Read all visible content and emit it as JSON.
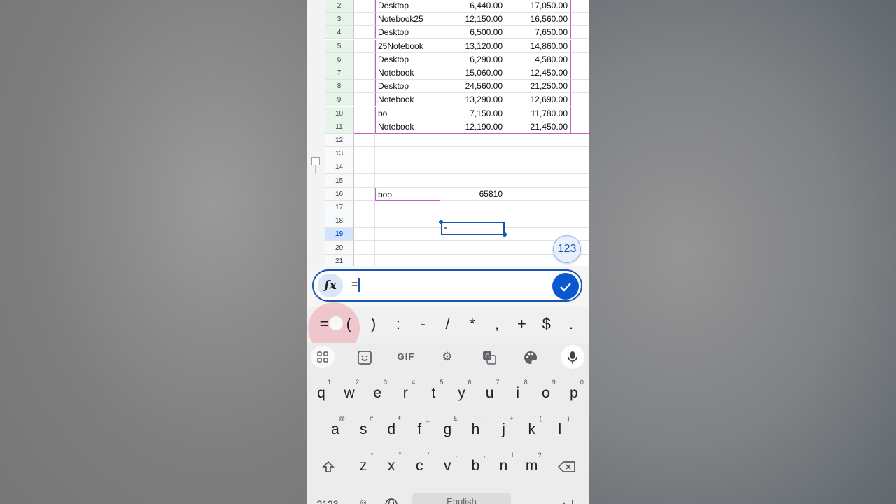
{
  "sheet": {
    "rows": [
      {
        "num": "2",
        "a": "Desktop",
        "b": "6,440.00",
        "c": "17,050.00"
      },
      {
        "num": "3",
        "a": "Notebook25",
        "b": "12,150.00",
        "c": "16,560.00"
      },
      {
        "num": "4",
        "a": "Desktop",
        "b": "6,500.00",
        "c": "7,650.00"
      },
      {
        "num": "5",
        "a": "25Notebook",
        "b": "13,120.00",
        "c": "14,860.00"
      },
      {
        "num": "6",
        "a": "Desktop",
        "b": "6,290.00",
        "c": "4,580.00"
      },
      {
        "num": "7",
        "a": "Notebook",
        "b": "15,060.00",
        "c": "12,450.00"
      },
      {
        "num": "8",
        "a": "Desktop",
        "b": "24,560.00",
        "c": "21,250.00"
      },
      {
        "num": "9",
        "a": "Notebook",
        "b": "13,290.00",
        "c": "12,690.00"
      },
      {
        "num": "10",
        "a": "bo",
        "b": "7,150.00",
        "c": "11,780.00"
      },
      {
        "num": "11",
        "a": "Notebook",
        "b": "12,190.00",
        "c": "21,450.00"
      }
    ],
    "empty_rows": [
      "12",
      "13",
      "14",
      "15",
      "16",
      "17",
      "18",
      "19",
      "20",
      "21"
    ],
    "row16_a": "boo",
    "row16_b": "65810",
    "active_cell_text": "=",
    "badge": "123"
  },
  "formula": {
    "icon": "fx",
    "text": "="
  },
  "symbols": [
    "=",
    "(",
    ")",
    ":",
    "-",
    "/",
    "*",
    ",",
    "+",
    "$",
    "."
  ],
  "toolbar": {
    "gif_label": "GIF"
  },
  "keyboard": {
    "row1": [
      [
        "q",
        "1"
      ],
      [
        "w",
        "2"
      ],
      [
        "e",
        "3"
      ],
      [
        "r",
        "4"
      ],
      [
        "t",
        "5"
      ],
      [
        "y",
        "6"
      ],
      [
        "u",
        "7"
      ],
      [
        "i",
        "8"
      ],
      [
        "o",
        "9"
      ],
      [
        "p",
        "0"
      ]
    ],
    "row2": [
      [
        "a",
        "@"
      ],
      [
        "s",
        "#"
      ],
      [
        "d",
        "₹"
      ],
      [
        "f",
        "_"
      ],
      [
        "g",
        "&"
      ],
      [
        "h",
        "-"
      ],
      [
        "j",
        "+"
      ],
      [
        "k",
        "("
      ],
      [
        "l",
        ")"
      ]
    ],
    "row3": [
      [
        "z",
        "*"
      ],
      [
        "x",
        "\""
      ],
      [
        "c",
        "'"
      ],
      [
        "v",
        ":"
      ],
      [
        "b",
        ";"
      ],
      [
        "n",
        "!"
      ],
      [
        "m",
        "?"
      ]
    ],
    "numbers_key": "?123",
    "space_label": "English"
  },
  "colors": {
    "accent": "#0b57d0",
    "select_border": "#1a56b0",
    "pink_border": "#c060c0",
    "green_border": "#34a853"
  }
}
